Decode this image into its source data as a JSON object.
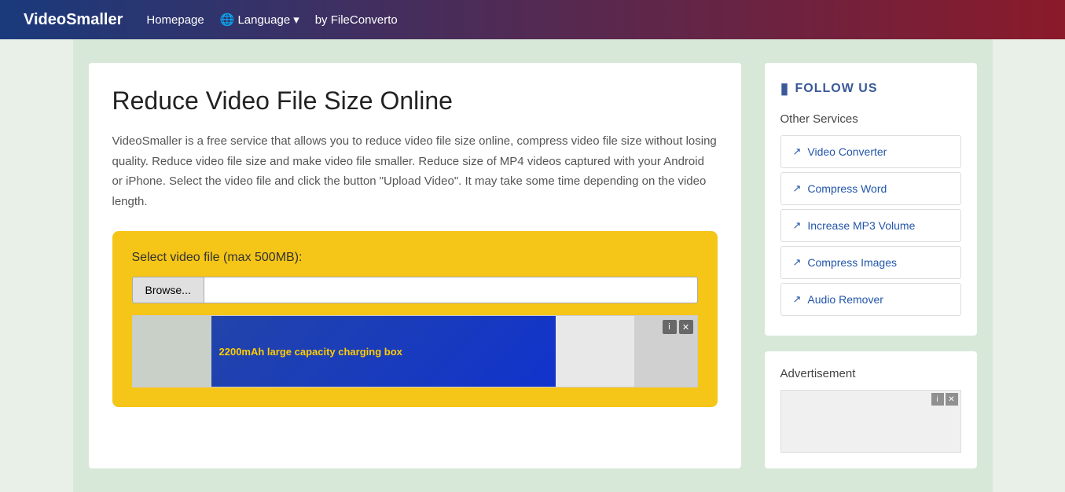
{
  "header": {
    "brand": "VideoSmaller",
    "nav": {
      "homepage": "Homepage",
      "language": "Language",
      "language_icon": "🌐",
      "by": "by FileConverto"
    }
  },
  "main": {
    "title": "Reduce Video File Size Online",
    "description": "VideoSmaller is a free service that allows you to reduce video file size online, compress video file size without losing quality. Reduce video file size and make video file smaller. Reduce size of MP4 videos captured with your Android or iPhone. Select the video file and click the button \"Upload Video\". It may take some time depending on the video length.",
    "upload": {
      "label": "Select video file (max 500MB):",
      "browse_btn": "Browse...",
      "file_placeholder": ""
    },
    "ad": {
      "text": "2200mAh large capacity charging box"
    }
  },
  "sidebar": {
    "follow_title": "FOLLOW US",
    "other_services_title": "Other Services",
    "services": [
      {
        "label": "Video Converter",
        "id": "video-converter"
      },
      {
        "label": "Compress Word",
        "id": "compress-word"
      },
      {
        "label": "Increase MP3 Volume",
        "id": "increase-mp3"
      },
      {
        "label": "Compress Images",
        "id": "compress-images"
      },
      {
        "label": "Audio Remover",
        "id": "audio-remover"
      }
    ],
    "ad_title": "Advertisement",
    "icons": {
      "close": "✕",
      "info": "i",
      "external": "↗"
    }
  }
}
